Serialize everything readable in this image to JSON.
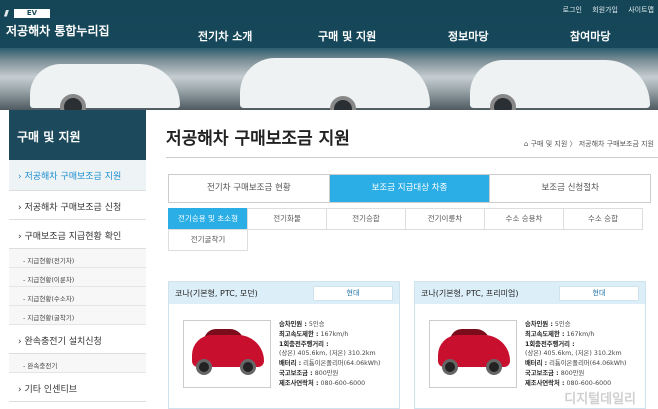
{
  "site": {
    "badge": "EV",
    "title": "저공해차 통합누리집"
  },
  "util_links": [
    "로그인",
    "회원가입",
    "사이트맵"
  ],
  "gnb": [
    "전기차 소개",
    "구매 및 지원",
    "정보마당",
    "참여마당"
  ],
  "sidebar": {
    "title": "구매 및 지원",
    "items": [
      {
        "label": "› 저공해차 구매보조금 지원",
        "type": "active"
      },
      {
        "label": "› 저공해차 구매보조금 신청",
        "type": "item"
      },
      {
        "label": "› 구매보조금 지급현황 확인",
        "type": "item"
      },
      {
        "label": "- 지급현황(전기차)",
        "type": "sub"
      },
      {
        "label": "- 지급현황(이륜차)",
        "type": "sub"
      },
      {
        "label": "- 지급현황(수소차)",
        "type": "sub"
      },
      {
        "label": "- 지급현황(굴착기)",
        "type": "sub"
      },
      {
        "label": "› 완속충전기 설치신청",
        "type": "item"
      },
      {
        "label": "- 완속충전기",
        "type": "sub"
      },
      {
        "label": "› 기타 인센티브",
        "type": "item"
      }
    ]
  },
  "page": {
    "title": "저공해차 구매보조금 지원",
    "breadcrumb": "구매 및 지원 〉 저공해차 구매보조금 지원"
  },
  "tabs": [
    "전기차 구매보조금 현황",
    "보조금 지급대상 차종",
    "보조금 신청절차"
  ],
  "subtabs": [
    "전기승용 및 초소형",
    "전기화물",
    "전기승합",
    "전기이륜차",
    "수소 승용차",
    "수소 승합",
    "전기굴착기"
  ],
  "cards": [
    {
      "name": "코나(기본형, PTC, 모던)",
      "brand": "현대",
      "specs": [
        [
          "승차인원 :",
          "5인승"
        ],
        [
          "최고속도제한 :",
          "167km/h"
        ],
        [
          "1회충전주행거리 :",
          ""
        ],
        [
          "",
          "(상온) 405.6km, (저온) 310.2km"
        ],
        [
          "배터리 :",
          "리튬이온폴리머(64.06kWh)"
        ],
        [
          "국고보조금 :",
          "800만원"
        ],
        [
          "제조사연락처 :",
          "080-600-6000"
        ]
      ]
    },
    {
      "name": "코나(기본형, PTC, 프리미엄)",
      "brand": "현대",
      "specs": [
        [
          "승차인원 :",
          "5인승"
        ],
        [
          "최고속도제한 :",
          "167km/h"
        ],
        [
          "1회충전주행거리 :",
          ""
        ],
        [
          "",
          "(상온) 405.6km, (저온) 310.2km"
        ],
        [
          "배터리 :",
          "리튬이온폴리머(64.06kWh)"
        ],
        [
          "국고보조금 :",
          "800만원"
        ],
        [
          "제조사연락처 :",
          "080-600-6000"
        ]
      ]
    }
  ],
  "watermark": "디지털데일리",
  "colors": {
    "primary": "#1c4a5c",
    "accent": "#2baee6",
    "card_head": "#dceef8"
  },
  "icons": {
    "home": "home-icon"
  }
}
